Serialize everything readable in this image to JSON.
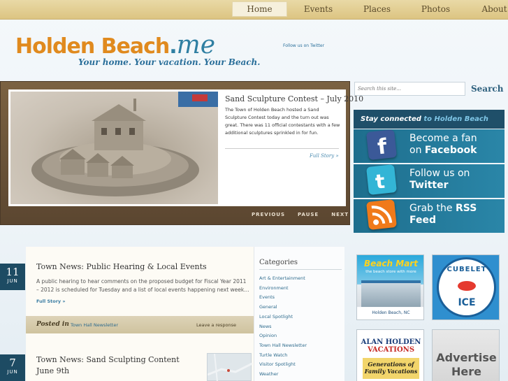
{
  "nav": {
    "items": [
      {
        "label": "Home",
        "active": true
      },
      {
        "label": "Events",
        "active": false
      },
      {
        "label": "Places",
        "active": false
      },
      {
        "label": "Photos",
        "active": false
      },
      {
        "label": "About",
        "active": false
      }
    ]
  },
  "header": {
    "logo_word": "Holden Beach",
    "logo_dot": ".",
    "logo_suffix": "me",
    "tagline": "Your home. Your vacation. Your Beach.",
    "twitter_link": "Follow us on Twitter"
  },
  "slideshow": {
    "title": "Sand Sculpture Contest – July 2010",
    "body": "The Town of Holden Beach hosted a Sand Sculpture Contest today and the turn out was great. There was 11 official contestants with a few additional sculptures sprinkled in for fun.",
    "more_label": "Full Story »",
    "controls": {
      "previous": "PREVIOUS",
      "pause": "PAUSE",
      "next": "NEXT"
    }
  },
  "search": {
    "placeholder": "Search this site...",
    "button_label": "Search"
  },
  "stay_connected": {
    "header_prefix": "Stay connected",
    "header_accent": "to Holden Beach",
    "facebook": {
      "line1": "Become a fan",
      "line2_pre": "on ",
      "line2_bold": "Facebook"
    },
    "twitter": {
      "line1": "Follow us on",
      "line2_bold": "Twitter"
    },
    "rss": {
      "line1_pre": "Grab the ",
      "line1_bold": "RSS",
      "line2_bold": "Feed"
    },
    "colors": {
      "facebook": "#3b5998",
      "twitter": "#33b5d6",
      "rss": "#f07a1a"
    }
  },
  "posts": [
    {
      "day": "11",
      "month": "JUN",
      "title": "Town News: Public Hearing & Local Events",
      "body": "A public hearing to hear comments on the proposed budget for Fiscal Year 2011 – 2012 is scheduled for Tuesday and a list of local events happening next week…",
      "more_label": "Full Story »",
      "posted_in_label": "Posted in",
      "category": "Town Hall Newsletter",
      "response_label": "Leave a response"
    },
    {
      "day": "7",
      "month": "JUN",
      "title": "Town News: Sand Sculpting Content June 9th"
    }
  ],
  "categories": {
    "title": "Categories",
    "items": [
      "Art & Entertainment",
      "Environment",
      "Events",
      "General",
      "Local Spotlight",
      "News",
      "Opinion",
      "Town Hall Newsletter",
      "Turtle Watch",
      "Visitor Spotlight",
      "Weather"
    ]
  },
  "ads": {
    "beachmart": {
      "title": "Beach Mart",
      "subtitle": "the beach store with more",
      "location": "Holden Beach, NC"
    },
    "cubelet": {
      "top": "CUBELET",
      "bottom": "ICE"
    },
    "alan": {
      "logo_pre": "ALAN HOLDEN ",
      "logo_accent": "VACATIONS",
      "slogan": "Generations of Family Vacations"
    },
    "advertise": {
      "text": "Advertise Here"
    }
  }
}
